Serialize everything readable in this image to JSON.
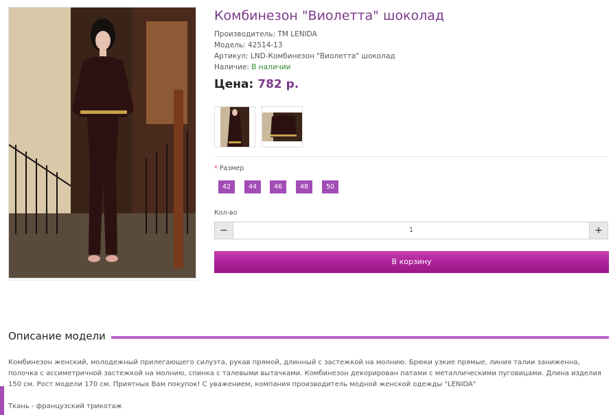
{
  "product": {
    "title": "Комбинезон \"Виолетта\" шоколад",
    "manufacturer": "Производитель: ТМ LENIDA",
    "model": "Модель: 42514-13",
    "sku": "Артикул: LND-Комбинезон \"Виолетта\" шоколад",
    "availability_label": "Наличие: ",
    "availability_value": "В наличии",
    "price_label": "Цена:",
    "price_value": "782 р."
  },
  "options": {
    "required_mark": "*",
    "size_label": "Размер",
    "sizes": [
      "42",
      "44",
      "46",
      "48",
      "50"
    ]
  },
  "quantity": {
    "label": "Кол-во",
    "minus": "−",
    "value": "1",
    "plus": "+"
  },
  "cart": {
    "button_label": "В корзину"
  },
  "description": {
    "heading": "Описание модели",
    "text": "Комбинезон женский, молодежный прилегающего силуэта, рукав прямой, длинный с застежкой на молнию. Брюки узкие прямые, линия талии заниженна, полочка с ассиметричной застежкой на молнию, спинка с талевыми вытачками. Комбинезон декорирован патами с металлическими пуговицами. Длина изделия 150 см. Рост модели 170 см. Приятных Вам покупок! С уважением, компания производитель модной женской одежды \"LENIDA\"",
    "fabric": "Ткань - французский трикотаж"
  },
  "colors": {
    "accent": "#7b3a8a",
    "size_button": "#a24cb5",
    "cart_button": "#b0259d",
    "in_stock": "#2e8b2e"
  }
}
